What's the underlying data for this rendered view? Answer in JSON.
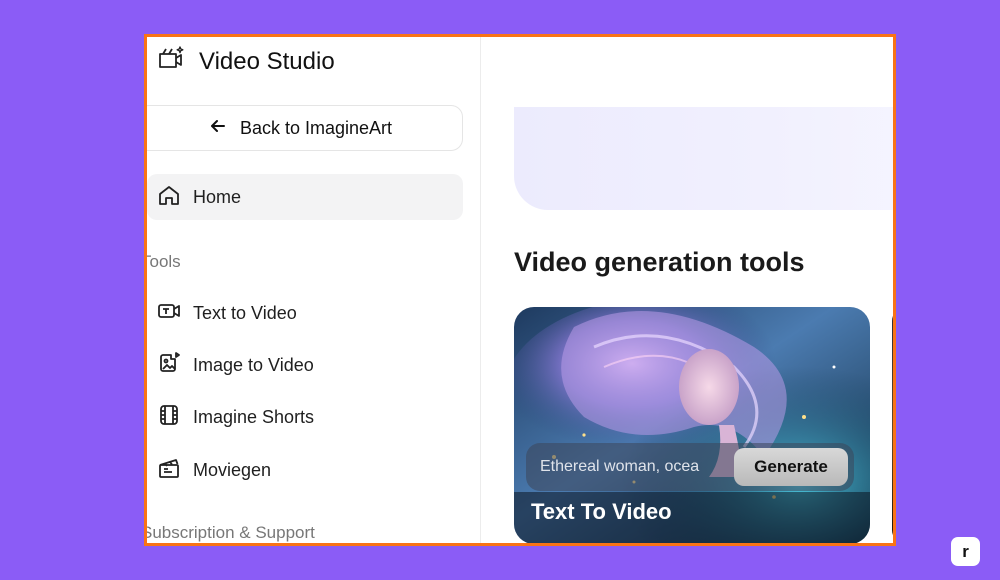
{
  "sidebar": {
    "app_title": "Video Studio",
    "app_icon": "video-sparkle-icon",
    "back_label": "Back to ImagineArt",
    "home_label": "Home",
    "tools_heading": "Tools",
    "tools": [
      {
        "label": "Text to Video",
        "icon": "text-video-icon"
      },
      {
        "label": "Image to Video",
        "icon": "image-video-icon"
      },
      {
        "label": "Imagine Shorts",
        "icon": "film-icon"
      },
      {
        "label": "Moviegen",
        "icon": "clapperboard-icon"
      }
    ],
    "subscription_heading": "Subscription & Support"
  },
  "main": {
    "section_title": "Video generation tools",
    "card": {
      "title": "Text To Video",
      "prompt_value": "Ethereal woman, ocea",
      "generate_label": "Generate"
    }
  },
  "corner_badge": "r",
  "colors": {
    "background": "#8b5cf6",
    "frame_border": "#f97316",
    "banner": "#ecebfd"
  }
}
